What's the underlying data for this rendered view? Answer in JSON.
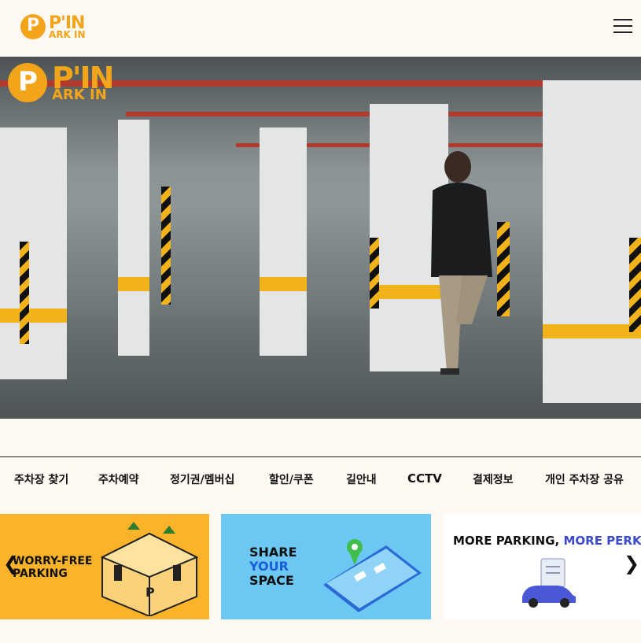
{
  "header": {
    "logo_letter": "P",
    "logo_big": "P'IN",
    "logo_small": "ARK IN"
  },
  "hero": {
    "logo_letter": "P",
    "logo_big": "P'IN",
    "logo_small": "ARK IN"
  },
  "nav": {
    "items": [
      "주차장 찾기",
      "주차예약",
      "정기권/멤버십",
      "할인/쿠폰",
      "길안내",
      "CCTV",
      "결제정보",
      "개인 주차장 공유"
    ]
  },
  "banners": {
    "b1": {
      "line1": "WORRY-FREE",
      "line2": "PARKING"
    },
    "b2": {
      "line1": "SHARE",
      "line2": "YOUR",
      "line3": "SPACE"
    },
    "b3": {
      "part1": "MORE PARKING, ",
      "part2": "MORE PERKS"
    }
  },
  "arrows": {
    "prev": "❮",
    "next": "❯"
  },
  "colors": {
    "brand": "#f2a51a",
    "background": "#fdf8f2"
  }
}
